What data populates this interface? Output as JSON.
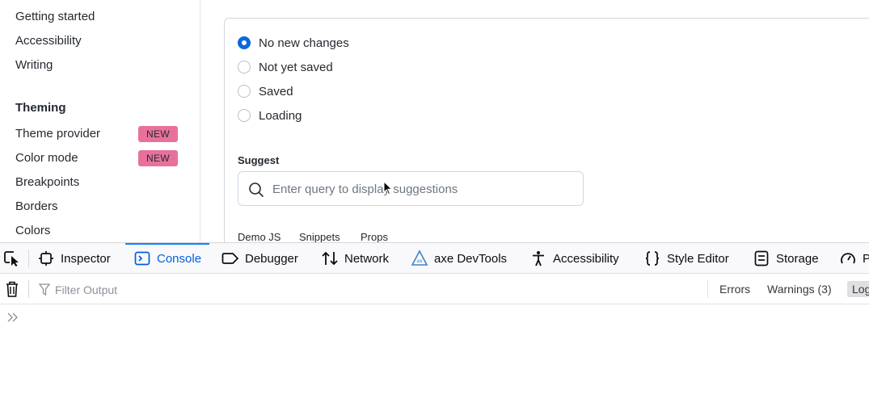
{
  "sidebar": {
    "items_top": [
      "Getting started",
      "Accessibility",
      "Writing"
    ],
    "heading": "Theming",
    "items": [
      {
        "label": "Theme provider",
        "badge": "NEW"
      },
      {
        "label": "Color mode",
        "badge": "NEW"
      },
      {
        "label": "Breakpoints",
        "badge": ""
      },
      {
        "label": "Borders",
        "badge": ""
      },
      {
        "label": "Colors",
        "badge": ""
      }
    ],
    "badge_color": "#e8719c"
  },
  "main": {
    "radios": [
      {
        "label": "No new changes",
        "checked": true
      },
      {
        "label": "Not yet saved",
        "checked": false
      },
      {
        "label": "Saved",
        "checked": false
      },
      {
        "label": "Loading",
        "checked": false
      }
    ],
    "suggest": {
      "label": "Suggest",
      "placeholder": "Enter query to display suggestions"
    },
    "tabs": [
      "Demo JS",
      "Snippets",
      "Props"
    ],
    "accent": "#0969da"
  },
  "devtools": {
    "tabs": [
      {
        "label": "Inspector",
        "icon": "inspector-icon",
        "active": false
      },
      {
        "label": "Console",
        "icon": "console-icon",
        "active": true
      },
      {
        "label": "Debugger",
        "icon": "debugger-icon",
        "active": false
      },
      {
        "label": "Network",
        "icon": "network-icon",
        "active": false
      },
      {
        "label": "axe DevTools",
        "icon": "axe-icon",
        "active": false
      },
      {
        "label": "Accessibility",
        "icon": "accessibility-icon",
        "active": false
      },
      {
        "label": "Style Editor",
        "icon": "style-editor-icon",
        "active": false
      },
      {
        "label": "Storage",
        "icon": "storage-icon",
        "active": false
      },
      {
        "label": "P",
        "icon": "performance-icon",
        "active": false
      }
    ],
    "filter_placeholder": "Filter Output",
    "levels": [
      "Errors",
      "Warnings (3)",
      "Logs"
    ],
    "accent": "#0060df"
  }
}
